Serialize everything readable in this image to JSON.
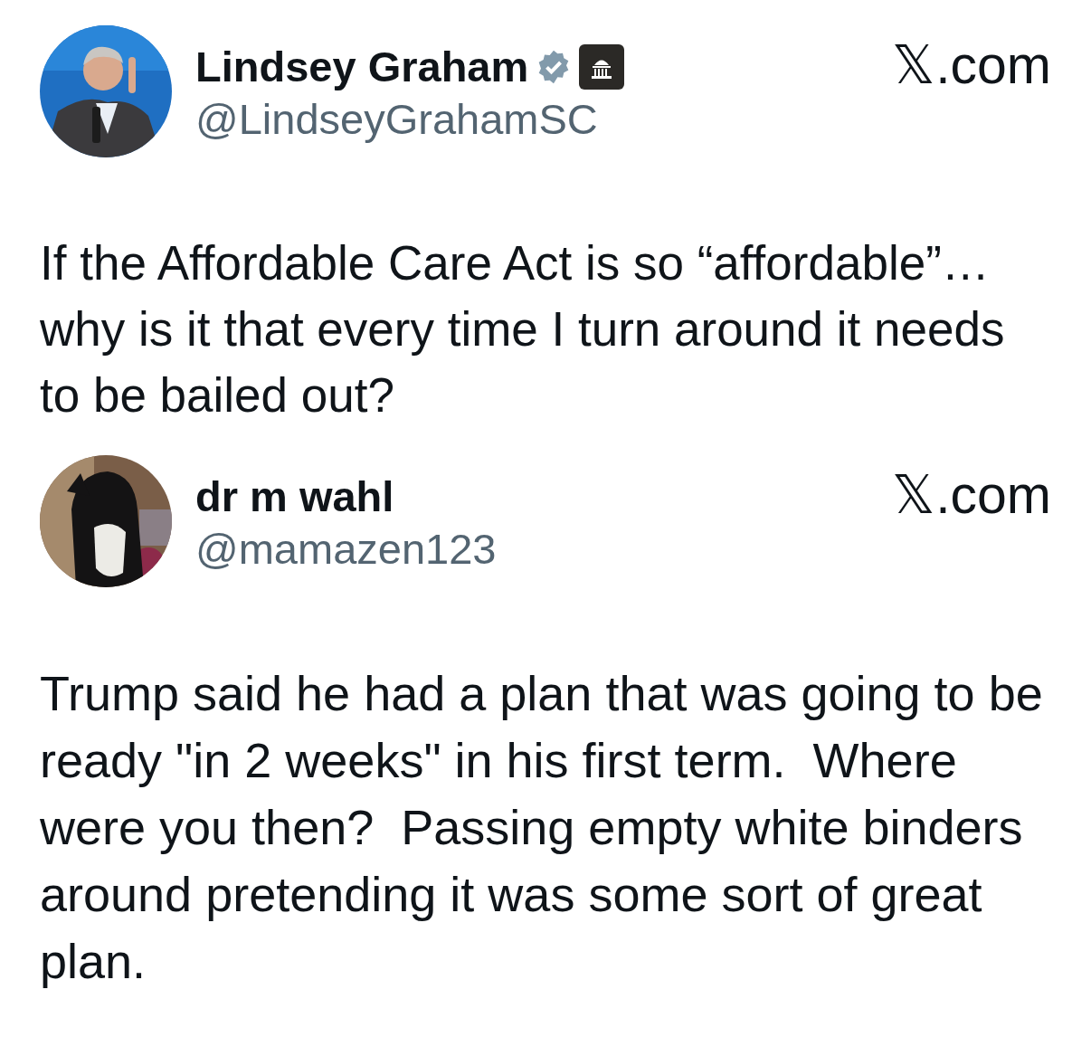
{
  "posts": [
    {
      "name": "Lindsey Graham",
      "verified": true,
      "affiliation_badge": true,
      "handle": "@LindseyGrahamSC",
      "source": "𝕏.com",
      "text": "If the Affordable Care Act is so “affordable”… why is it that every time I turn around it needs to be bailed out?"
    },
    {
      "name": "dr m wahl",
      "verified": false,
      "affiliation_badge": false,
      "handle": "@mamazen123",
      "source": "𝕏.com",
      "text": "Trump said he had a plan that was going to be ready \"in 2 weeks\" in his first term.  Where were you then?  Passing empty white binders around pretending it was some sort of great plan."
    }
  ]
}
